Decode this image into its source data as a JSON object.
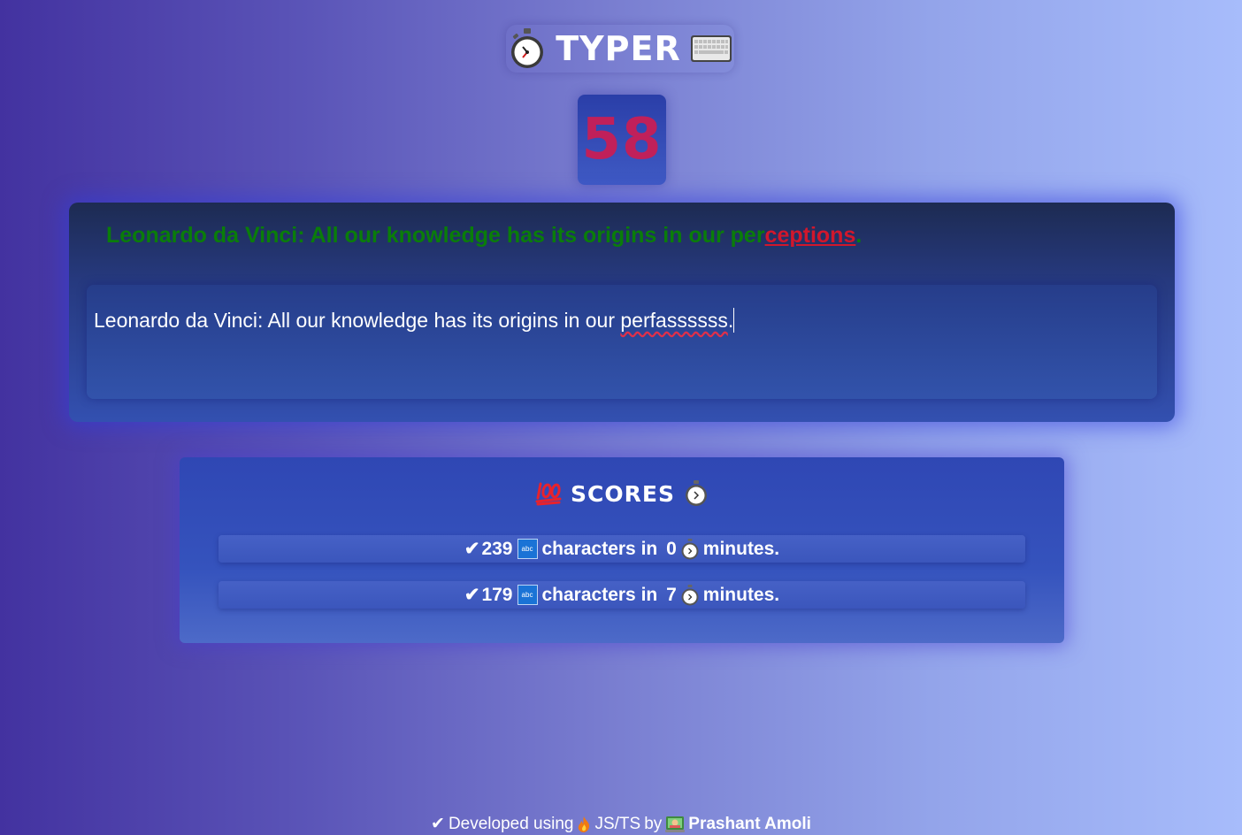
{
  "header": {
    "title": "TYPER",
    "left_icon": "stopwatch-icon",
    "right_icon": "keyboard-icon"
  },
  "timer": {
    "value": "58"
  },
  "quote": {
    "correct_part": "Leonardo da Vinci: All our knowledge has its origins in our per",
    "wrong_part": "ceptions",
    "trailing_part": "."
  },
  "input": {
    "typed_plain": "Leonardo da Vinci: All our knowledge has its origins in our ",
    "typed_misspelled": "perfassssss",
    "typed_end": "."
  },
  "scores": {
    "title": "SCORES",
    "title_left_icon": "hundred-points-icon",
    "title_right_icon": "stopwatch-icon",
    "rows": [
      {
        "check": "✔",
        "characters": "239",
        "middle_text": "characters in",
        "minutes": "0",
        "end_text": "minutes."
      },
      {
        "check": "✔",
        "characters": "179",
        "middle_text": "characters in",
        "minutes": "7",
        "end_text": "minutes."
      }
    ],
    "abc_label": "abc"
  },
  "footer": {
    "check": "✔",
    "developed_text": "Developed using",
    "tech": "JS/TS",
    "by_text": "by",
    "author": "Prashant Amoli"
  },
  "colors": {
    "timer_text": "#c0205a",
    "correct_text": "#0a7d0a",
    "wrong_text": "#d1172c"
  }
}
